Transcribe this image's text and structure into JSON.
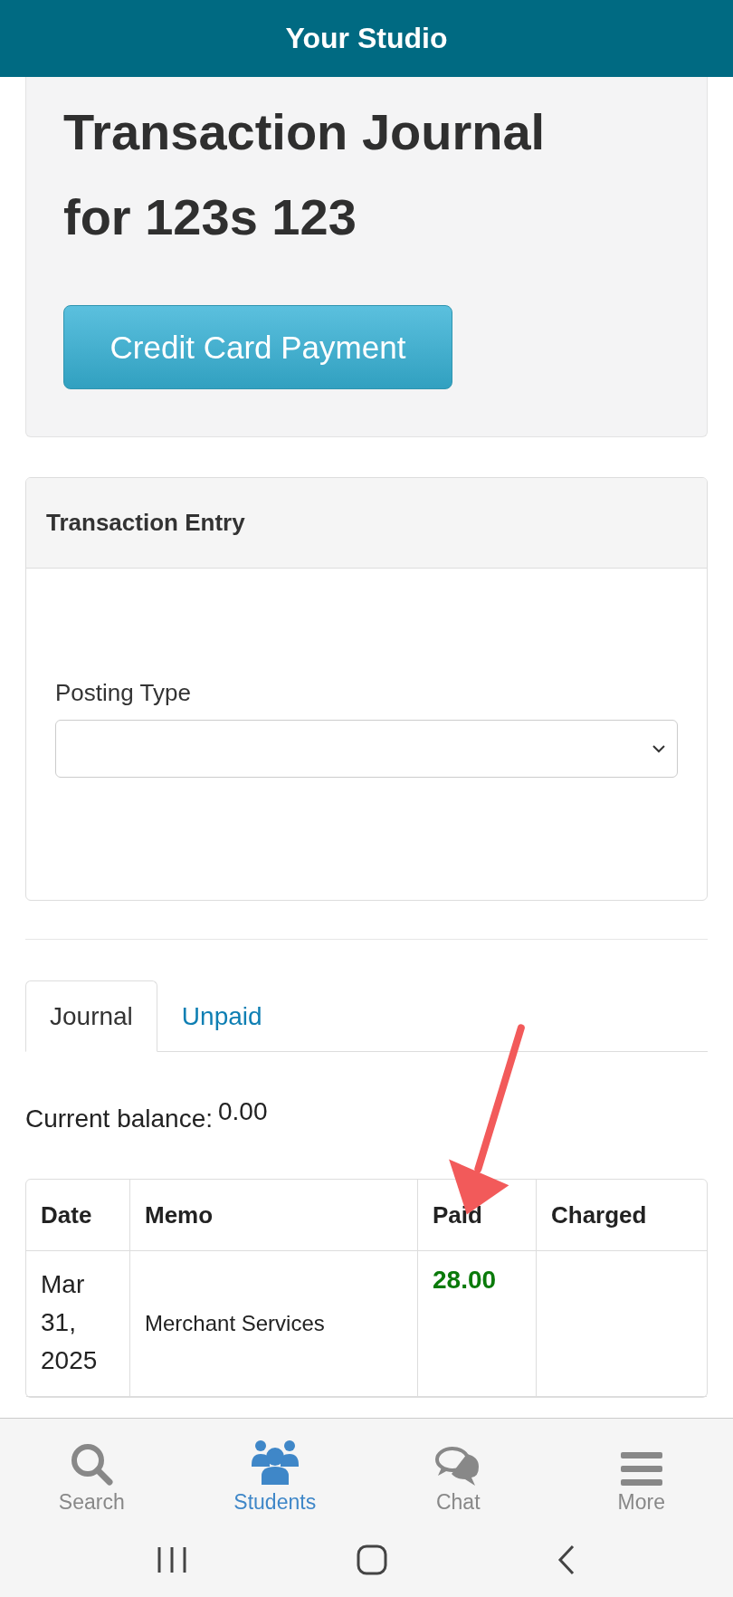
{
  "header": {
    "title": "Your Studio"
  },
  "page": {
    "title": "Transaction Journal for 123s 123",
    "button": "Credit Card Payment"
  },
  "entry_panel": {
    "title": "Transaction Entry",
    "field_label": "Posting Type"
  },
  "tabs": [
    {
      "label": "Journal",
      "selected": true
    },
    {
      "label": "Unpaid",
      "selected": false
    }
  ],
  "balance": {
    "label": "Current balance:",
    "value": "0.00"
  },
  "table": {
    "columns": [
      "Date",
      "Memo",
      "Paid",
      "Charged"
    ],
    "rows": [
      {
        "date": "Mar 31, 2025",
        "memo": "Merchant Services",
        "paid": "28.00"
      }
    ]
  },
  "bottom_nav": [
    {
      "label": "Search",
      "selected": false
    },
    {
      "label": "Students",
      "selected": true
    },
    {
      "label": "Chat",
      "selected": false
    },
    {
      "label": "More",
      "selected": false
    }
  ]
}
